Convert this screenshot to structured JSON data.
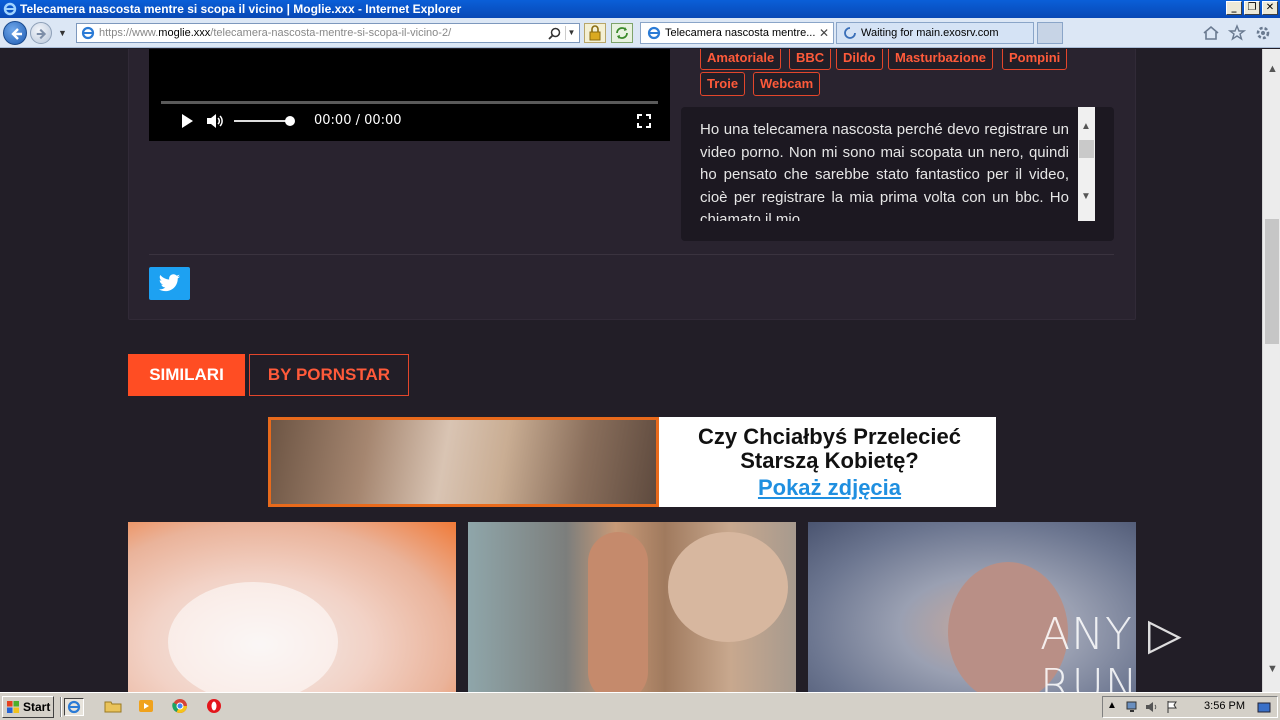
{
  "window": {
    "title": "Telecamera nascosta mentre si scopa il vicino | Moglie.xxx - Internet Explorer",
    "minimize": "_",
    "maximize": "❐",
    "close": "✕"
  },
  "navbar": {
    "url_prefix": "https://www.",
    "url_host": "moglie.xxx",
    "url_path": "/telecamera-nascosta-mentre-si-scopa-il-vicino-2/",
    "tabs": [
      {
        "label": "Telecamera nascosta mentre..."
      },
      {
        "label": "Waiting for main.exosrv.com"
      }
    ],
    "tab_close": "✕"
  },
  "video": {
    "time": "00:00 / 00:00",
    "volume_fraction": 0.9
  },
  "tags": [
    "Amatoriale",
    "BBC",
    "Dildo",
    "Masturbazione",
    "Pompini",
    "Troie",
    "Webcam"
  ],
  "description": "Ho una telecamera nascosta perché devo registrare un video porno. Non mi sono mai scopata un nero, quindi ho pensato che sarebbe stato fantastico per il video, cioè per registrare la mia prima volta con un bbc. Ho chiamato il mio",
  "tabs_section": {
    "similari": "SIMILARI",
    "by_pornstar": "BY PORNSTAR"
  },
  "banner": {
    "line1": "Czy Chciałbyś Przelecieć",
    "line2": "Starszą Kobietę?",
    "cta": "Pokaż zdjęcia"
  },
  "watermark": "ANY ▷ RUN",
  "taskbar": {
    "start": "Start",
    "clock": "3:56 PM"
  },
  "colors": {
    "accent": "#ff4d23",
    "background": "#221e27",
    "twitter": "#1da1f2"
  }
}
